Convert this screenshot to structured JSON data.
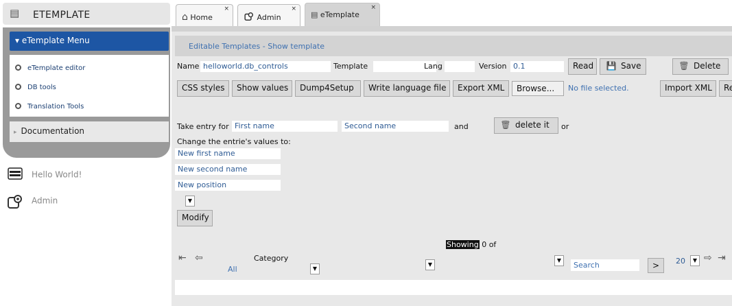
{
  "app": {
    "title": "ETEMPLATE"
  },
  "sidebar": {
    "menu_title": "eTemplate Menu",
    "items": [
      {
        "label": "eTemplate editor"
      },
      {
        "label": "DB tools"
      },
      {
        "label": "Translation Tools"
      }
    ],
    "documentation": "Documentation",
    "apps": [
      {
        "label": "Hello World!",
        "icon": "hello-world-icon"
      },
      {
        "label": "Admin",
        "icon": "admin-icon"
      }
    ]
  },
  "tabs": [
    {
      "label": "Home",
      "icon": "home-icon"
    },
    {
      "label": "Admin",
      "icon": "admin-icon"
    },
    {
      "label": "eTemplate",
      "icon": "etemplate-icon",
      "active": true
    }
  ],
  "main": {
    "breadcrumb": "Editable Templates - Show template",
    "name_label": "Name",
    "name_value": "helloworld.db_controls",
    "template_label": "Template",
    "template_value": "",
    "lang_label": "Lang",
    "lang_value": "",
    "version_label": "Version",
    "version_value": "0.1",
    "read_btn": "Read",
    "save_btn": "Save",
    "delete_btn": "Delete",
    "css_btn": "CSS styles",
    "show_values_btn": "Show values",
    "dump_btn": "Dump4Setup",
    "write_lang_btn": "Write language file",
    "export_btn": "Export XML",
    "browse_btn": "Browse...",
    "no_file": "No file selected.",
    "import_btn": "Import XML",
    "cut_btn": "Re",
    "take_entry": "Take entry for",
    "first_name": "First name",
    "second_name": "Second name",
    "and": "and",
    "delete_it": "delete it",
    "or": "or",
    "change_values": "Change the entrie's values to:",
    "new_first": "New first name",
    "new_second": "New second name",
    "new_position": "New position",
    "modify_btn": "Modify",
    "showing_hl": "Showing",
    "showing_rest": "0 of",
    "category_label": "Category",
    "category_value": "All",
    "search_placeholder": "Search",
    "go_btn": ">",
    "page_size": "20"
  }
}
